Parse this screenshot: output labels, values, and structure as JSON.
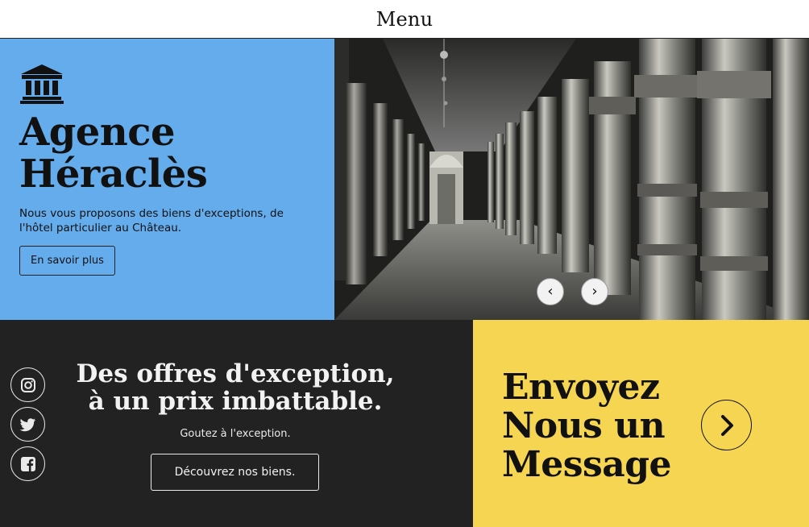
{
  "nav": {
    "menu_label": "Menu"
  },
  "hero": {
    "title_line1": "Agence",
    "title_line2": "Héraclès",
    "description": "Nous vous proposons des biens d'exceptions, de l'hôtel particulier au Château.",
    "cta_label": "En savoir plus",
    "icon": "bank-building-icon",
    "prev_glyph": "‹",
    "next_glyph": "›"
  },
  "offers": {
    "title_line1": "Des offres d'exception,",
    "title_line2": "à un prix imbattable.",
    "subtitle": "Goutez à l'exception.",
    "cta_label": "Découvrez nos biens.",
    "social_icons": [
      "instagram-icon",
      "twitter-icon",
      "facebook-icon"
    ]
  },
  "contact": {
    "title_line1": "Envoyez",
    "title_line2": "Nous un",
    "title_line3": "Message",
    "icon": "chevron-right-icon"
  },
  "colors": {
    "hero_blue": "#64aceb",
    "dark": "#222222",
    "yellow": "#f5d551"
  }
}
